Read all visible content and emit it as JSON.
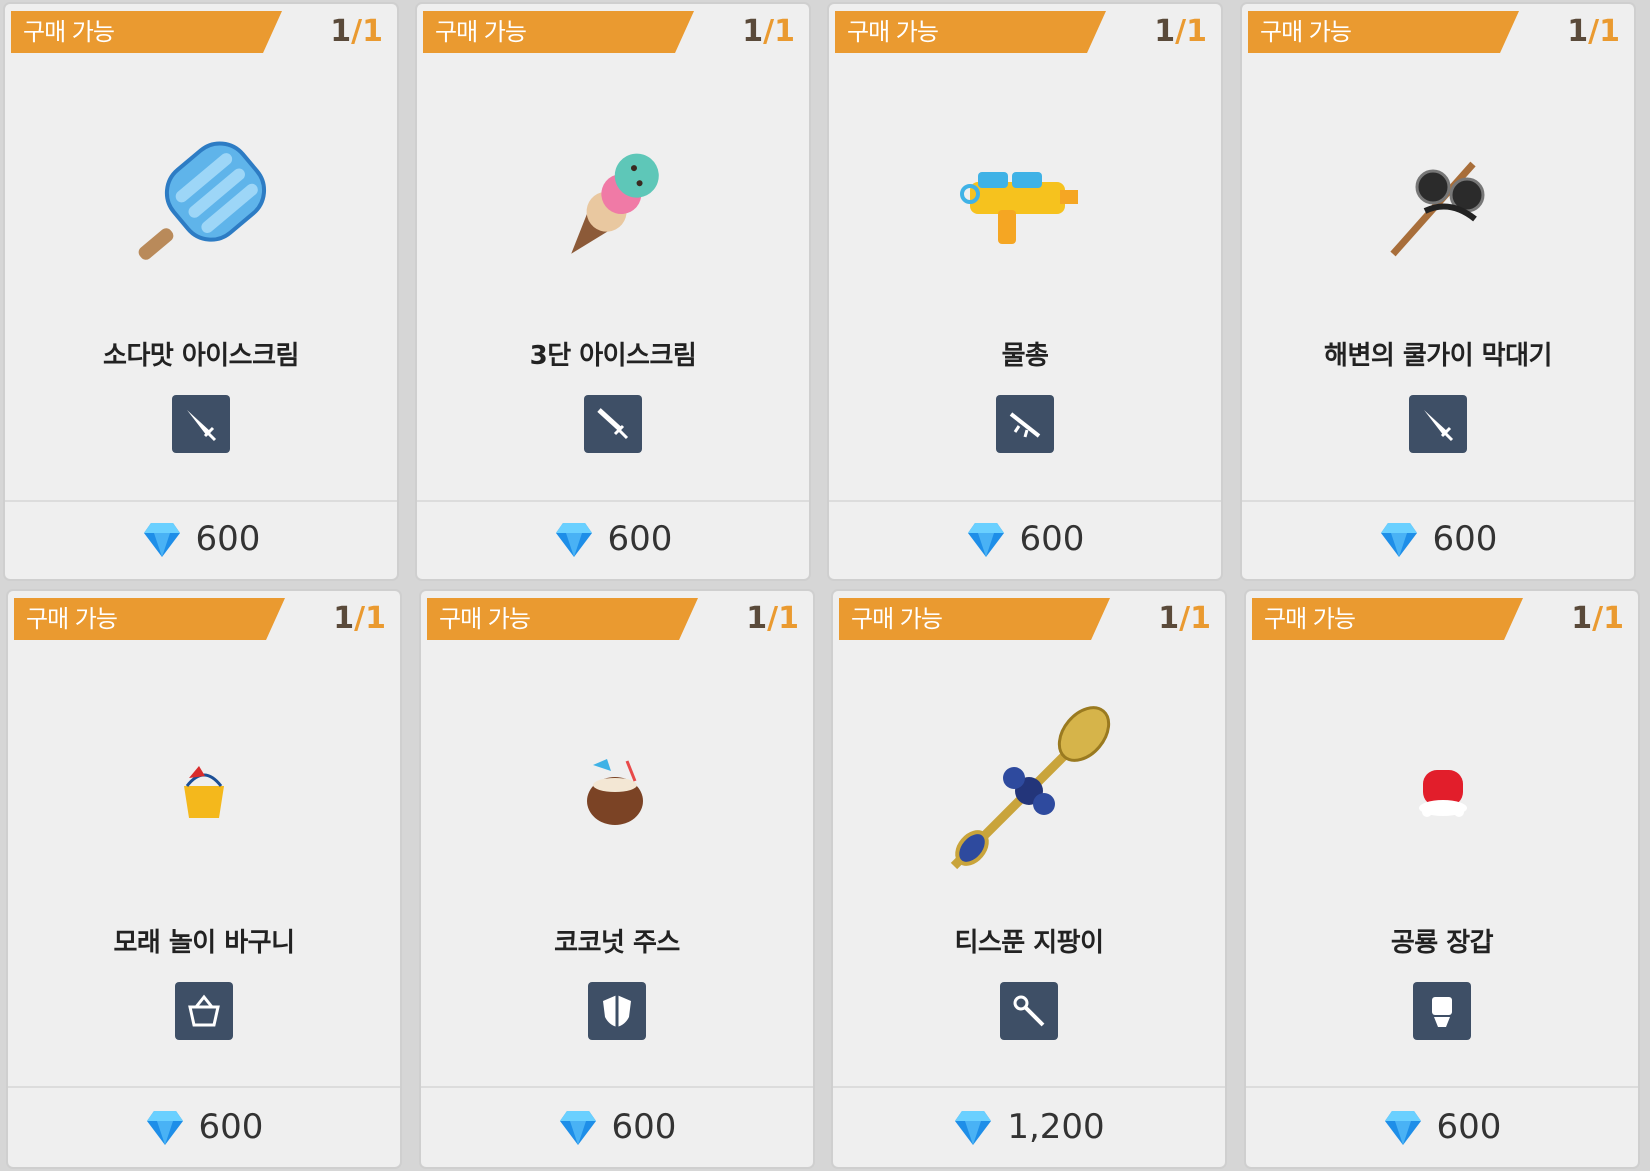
{
  "status_label": "구매 가능",
  "items": [
    {
      "name": "소다맛 아이스크림",
      "cur": "1",
      "max": "1",
      "icon": "sword-icon",
      "price": "600",
      "art": "popsicle"
    },
    {
      "name": "3단 아이스크림",
      "cur": "1",
      "max": "1",
      "icon": "dagger-icon",
      "price": "600",
      "art": "ice-cream-cone"
    },
    {
      "name": "물총",
      "cur": "1",
      "max": "1",
      "icon": "rifle-icon",
      "price": "600",
      "art": "water-gun"
    },
    {
      "name": "해변의 쿨가이 막대기",
      "cur": "1",
      "max": "1",
      "icon": "sword-icon",
      "price": "600",
      "art": "sunglasses-stick"
    },
    {
      "name": "모래 놀이 바구니",
      "cur": "1",
      "max": "1",
      "icon": "basket-icon",
      "price": "600",
      "art": "sand-bucket"
    },
    {
      "name": "코코넛 주스",
      "cur": "1",
      "max": "1",
      "icon": "shield-icon",
      "price": "600",
      "art": "coconut-juice"
    },
    {
      "name": "티스푼 지팡이",
      "cur": "1",
      "max": "1",
      "icon": "staff-icon",
      "price": "1,200",
      "art": "teaspoon-staff"
    },
    {
      "name": "공룡 장갑",
      "cur": "1",
      "max": "1",
      "icon": "fist-icon",
      "price": "600",
      "art": "dino-glove"
    }
  ]
}
